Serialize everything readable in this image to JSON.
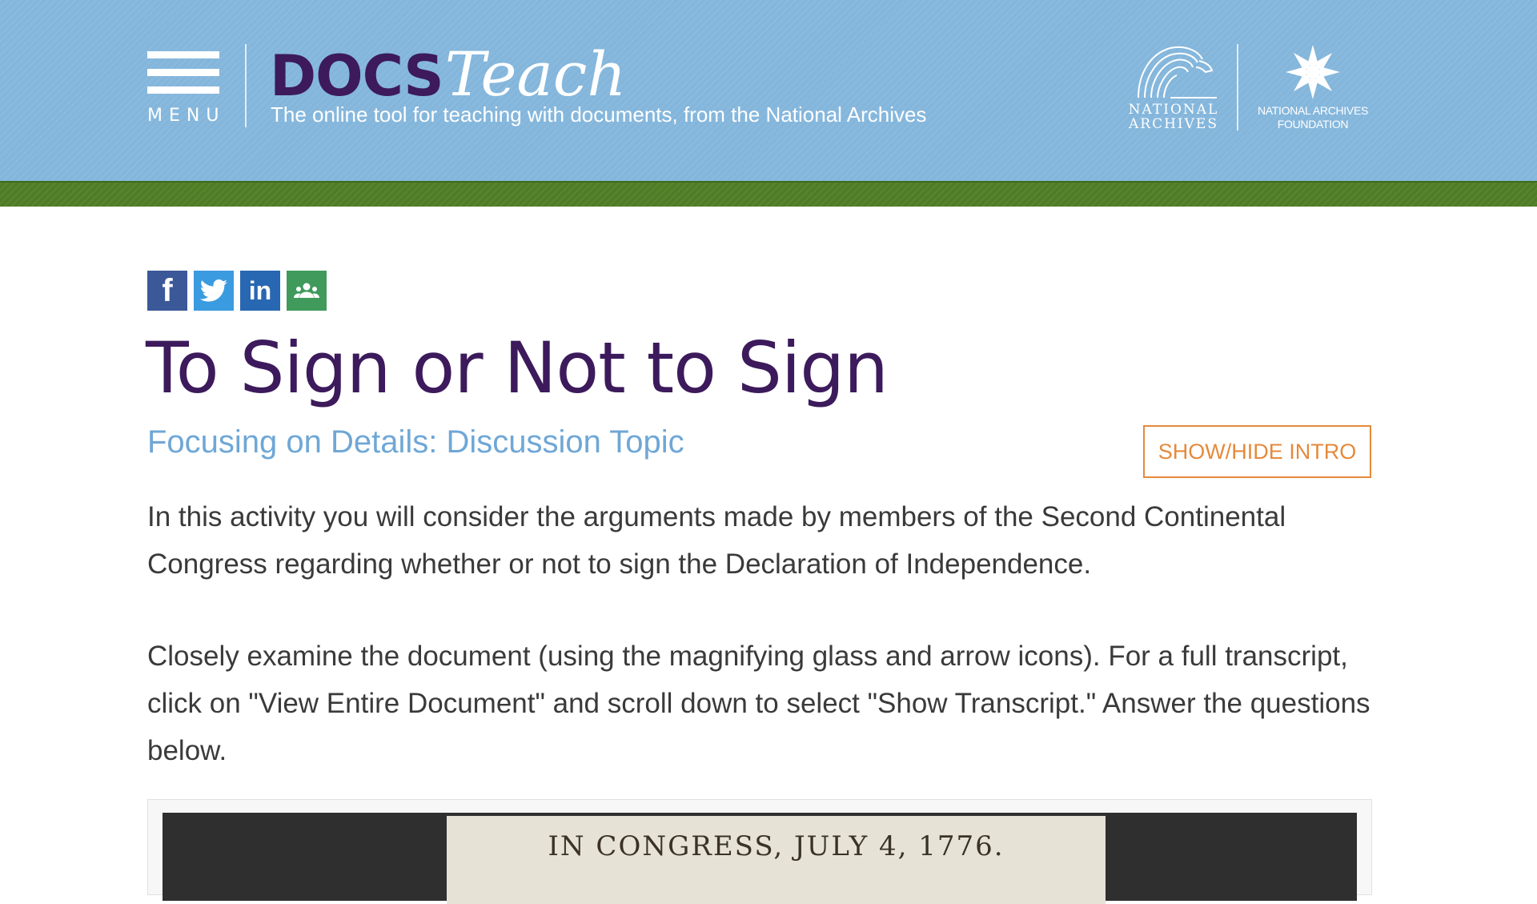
{
  "header": {
    "menu_label": "MENU",
    "logo_docs": "DOCS",
    "logo_teach": "Teach",
    "tagline": "The online tool for teaching with documents, from the National Archives",
    "partner_logos": {
      "national_archives": "NATIONAL ARCHIVES",
      "foundation_line1": "NATIONAL ARCHIVES",
      "foundation_line2": "FOUNDATION"
    }
  },
  "social": {
    "facebook": "f",
    "twitter": "twitter-bird-icon",
    "linkedin": "in",
    "classroom": "google-classroom-icon"
  },
  "activity": {
    "title": "To Sign or Not to Sign",
    "subtitle": "Focusing on Details: Discussion Topic",
    "toggle_label": "SHOW/HIDE INTRO",
    "intro_paragraphs": [
      "In this activity you will consider the arguments made by members of the Second Continental Congress regarding whether or not to sign the Declaration of Independence.",
      "Closely examine the document (using the magnifying glass and arrow icons).  For a full transcript, click on \"View Entire Document\" and scroll down to select \"Show Transcript.\" Answer the questions below."
    ]
  },
  "document": {
    "heading": "IN CONGRESS, JULY 4, 1776."
  },
  "colors": {
    "header_blue": "#84b6dc",
    "band_green": "#4f7d25",
    "title_purple": "#3c1a5b",
    "subtitle_blue": "#6fa7d6",
    "button_orange": "#e58a3c"
  }
}
